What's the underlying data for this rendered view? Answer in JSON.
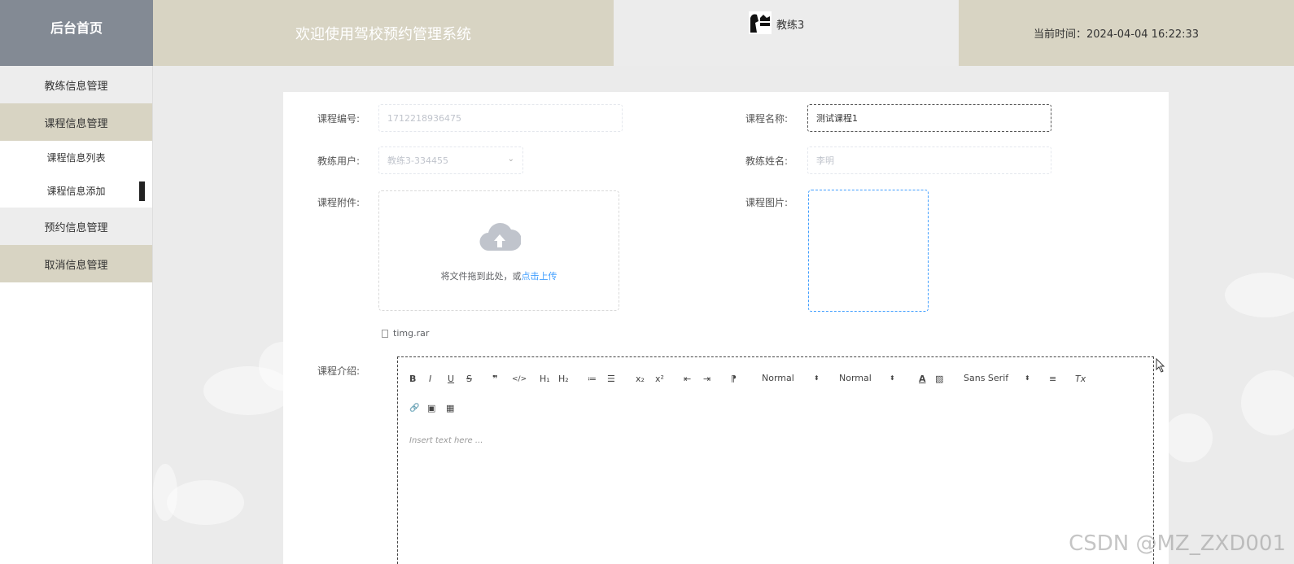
{
  "header": {
    "home_label": "后台首页",
    "welcome_text": "欢迎使用驾校预约管理系统",
    "username": "教练3",
    "time_label": "当前时间：2024-04-04 16:22:33"
  },
  "sidebar": {
    "items": [
      {
        "label": "教练信息管理"
      },
      {
        "label": "课程信息管理"
      },
      {
        "label": "课程信息列表"
      },
      {
        "label": "课程信息添加"
      },
      {
        "label": "预约信息管理"
      },
      {
        "label": "取消信息管理"
      }
    ]
  },
  "form": {
    "course_no_label": "课程编号:",
    "course_no_value": "1712218936475",
    "course_name_label": "课程名称:",
    "course_name_value": "测试课程1",
    "coach_user_label": "教练用户:",
    "coach_user_value": "教练3-334455",
    "coach_name_label": "教练姓名:",
    "coach_name_value": "李明",
    "attachment_label": "课程附件:",
    "upload_hint": "将文件拖到此处，或",
    "upload_link": "点击上传",
    "image_label": "课程图片:",
    "file_name": "timg.rar",
    "intro_label": "课程介绍:"
  },
  "editor": {
    "bold": "B",
    "italic": "I",
    "underline": "U",
    "strike": "S",
    "quote": "❞",
    "code": "</>",
    "h1": "H₁",
    "h2": "H₂",
    "ordered_list": "≔",
    "bullet_list": "☰",
    "subscript": "x₂",
    "superscript": "x²",
    "outdent": "⇤",
    "indent": "⇥",
    "direction": "⁋",
    "size_select": "Normal",
    "header_select": "Normal",
    "color": "A",
    "background": "▨",
    "font_select": "Sans Serif",
    "align": "≡",
    "clean": "Tx",
    "link": "🔗",
    "image": "▣",
    "video": "▦",
    "placeholder": "Insert text here ..."
  },
  "watermark": "CSDN @MZ_ZXD001"
}
